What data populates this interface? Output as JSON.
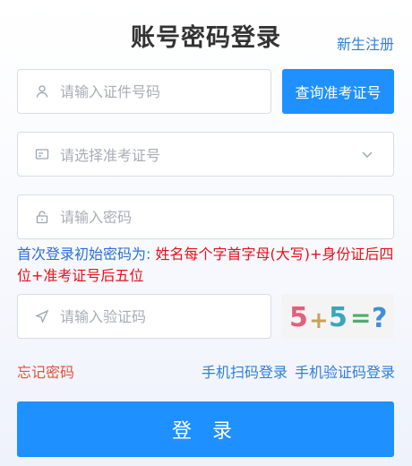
{
  "header": {
    "title": "账号密码登录",
    "register_link": "新生注册"
  },
  "fields": {
    "id_number": {
      "placeholder": "请输入证件号码",
      "icon": "user-icon"
    },
    "exam_number": {
      "placeholder": "请选择准考证号",
      "icon": "id-card-icon"
    },
    "password": {
      "placeholder": "请输入密码",
      "icon": "lock-icon"
    },
    "captcha": {
      "placeholder": "请输入验证码",
      "icon": "send-icon"
    }
  },
  "query_button": "查询准考证号",
  "hint": {
    "lead": "首次登录初始密码为: ",
    "rule": "姓名每个字首字母(大写)+身份证后四位+准考证号后五位"
  },
  "captcha_image": {
    "text": "5+5=?",
    "glyphs": [
      "5",
      "+",
      "5",
      "=",
      "?"
    ]
  },
  "links": {
    "forgot": "忘记密码",
    "qr_login": "手机扫码登录",
    "sms_login": "手机验证码登录"
  },
  "login_button": "登 录",
  "colors": {
    "primary": "#1e90ff",
    "link": "#2f7fd9",
    "warning": "#e8101b",
    "forgot": "#e8503a"
  }
}
